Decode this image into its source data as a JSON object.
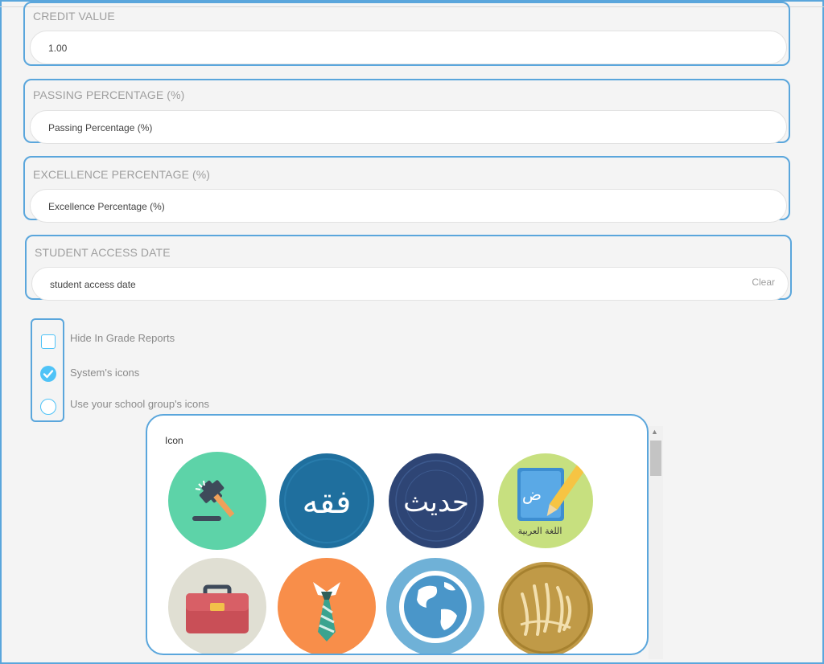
{
  "credit_value": {
    "label": "CREDIT VALUE",
    "value": "1.00"
  },
  "passing_percentage": {
    "label": "PASSING PERCENTAGE (%)",
    "placeholder": "Passing Percentage (%)"
  },
  "excellence_percentage": {
    "label": "EXCELLENCE PERCENTAGE (%)",
    "placeholder": "Excellence Percentage (%)"
  },
  "student_access_date": {
    "label": "STUDENT ACCESS DATE",
    "placeholder": "student access date",
    "clear_label": "Clear"
  },
  "options": {
    "hide_in_grade_reports": {
      "label": "Hide In Grade Reports",
      "checked": false
    },
    "systems_icons": {
      "label": "System's icons",
      "selected": true
    },
    "school_group_icons": {
      "label": "Use your school group's icons",
      "selected": false
    }
  },
  "icon_panel": {
    "title": "Icon",
    "icons": [
      {
        "name": "gavel-icon",
        "bg": "#5dd3a8"
      },
      {
        "name": "fiqh-icon",
        "text": "فقه",
        "bg": "#1f6f9e"
      },
      {
        "name": "hadith-icon",
        "text": "حديث",
        "bg": "#2e4575"
      },
      {
        "name": "arabic-language-icon",
        "letter": "ض",
        "caption": "اللغة العربية",
        "bg": "#c7e07f"
      },
      {
        "name": "briefcase-icon",
        "bg": "#e0dfd3"
      },
      {
        "name": "necktie-icon",
        "bg": "#f88e4a"
      },
      {
        "name": "globe-icon",
        "bg": "#6fb1d7"
      },
      {
        "name": "quran-icon",
        "bg": "#c09a47"
      }
    ]
  },
  "colors": {
    "accent": "#4fc3f7",
    "highlight_border": "#5aa6dc"
  }
}
